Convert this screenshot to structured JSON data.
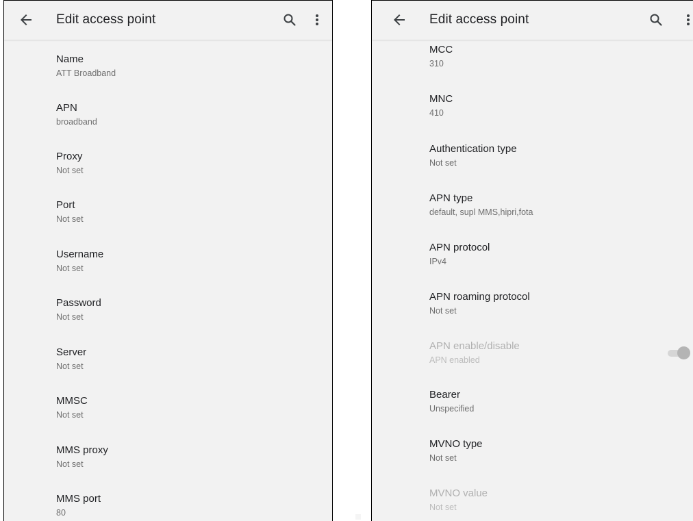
{
  "left": {
    "title": "Edit access point",
    "items": [
      {
        "title": "Name",
        "summary": "ATT Broadband"
      },
      {
        "title": "APN",
        "summary": "broadband"
      },
      {
        "title": "Proxy",
        "summary": "Not set"
      },
      {
        "title": "Port",
        "summary": "Not set"
      },
      {
        "title": "Username",
        "summary": "Not set"
      },
      {
        "title": "Password",
        "summary": "Not set"
      },
      {
        "title": "Server",
        "summary": "Not set"
      },
      {
        "title": "MMSC",
        "summary": "Not set"
      },
      {
        "title": "MMS proxy",
        "summary": "Not set"
      },
      {
        "title": "MMS port",
        "summary": "80"
      }
    ]
  },
  "right": {
    "title": "Edit access point",
    "items": [
      {
        "title": "MCC",
        "summary": "310"
      },
      {
        "title": "MNC",
        "summary": "410"
      },
      {
        "title": "Authentication type",
        "summary": "Not set"
      },
      {
        "title": "APN type",
        "summary": "default, supl MMS,hipri,fota"
      },
      {
        "title": "APN protocol",
        "summary": "IPv4"
      },
      {
        "title": "APN roaming protocol",
        "summary": "Not set"
      },
      {
        "title": "APN enable/disable",
        "summary": "APN enabled"
      },
      {
        "title": "Bearer",
        "summary": "Unspecified"
      },
      {
        "title": "MVNO type",
        "summary": "Not set"
      },
      {
        "title": "MVNO value",
        "summary": "Not set"
      }
    ],
    "apn_toggle_on": true
  },
  "icons": {
    "back": "arrow-back-icon",
    "search": "search-icon",
    "more": "more-vert-icon"
  },
  "colors": {
    "background": "#f2f2f2",
    "text_primary": "#202124",
    "text_secondary": "#6f6f6f",
    "text_disabled": "#b0b0b0"
  }
}
